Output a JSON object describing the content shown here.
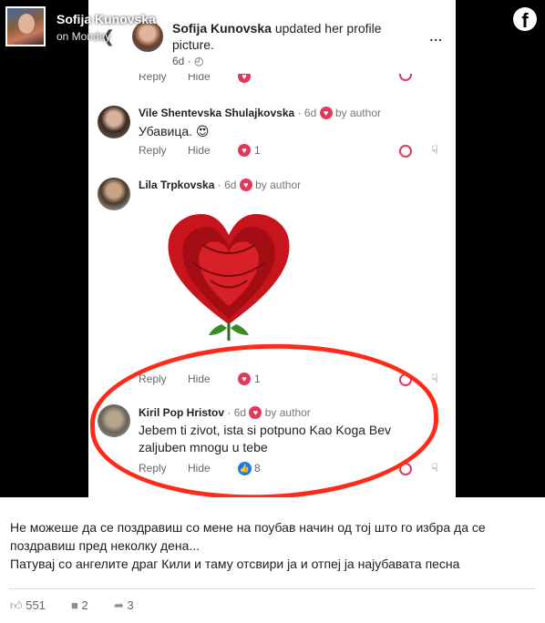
{
  "post": {
    "author": "Sofija Kunovska",
    "time": "on Monday"
  },
  "screenshot": {
    "title_name": "Sofija Kunovska",
    "title_rest": "updated her profile picture.",
    "time": "6d · ◴",
    "back_icon": "chevron-left-icon",
    "more": "...",
    "top_row": {
      "reply": "Reply",
      "hide": "Hide"
    },
    "comments": [
      {
        "name": "Vile Shentevska Shulajkovska",
        "time": "6d",
        "by_author": "by author",
        "text": "Убавица. 😍",
        "reply": "Reply",
        "hide": "Hide",
        "count": "1"
      },
      {
        "name": "Lila Trpkovska",
        "time": "6d",
        "by_author": "by author",
        "image": "heart-rose",
        "reply": "Reply",
        "hide": "Hide",
        "count": "1"
      },
      {
        "name": "Kiril Pop Hristov",
        "time": "6d",
        "by_author": "by author",
        "text": "Jebem ti zivot, ista si potpuno Kao Koga Bev zaljuben mnogu u tebe",
        "reply": "Reply",
        "hide": "Hide",
        "count": "8"
      }
    ]
  },
  "caption": {
    "line1": "Не можеше да се поздравиш со мене на поубав начин од тој што го избра да се",
    "line2": "поздравиш пред неколку дена...",
    "line3": "Патувај со ангелите драг Кили и таму отсвири ја и отпеј ја најубавата песна"
  },
  "stats": {
    "likes": "551",
    "comments": "2",
    "shares": "3"
  },
  "colors": {
    "facebook_blue": "#1877f2",
    "heart_red": "#e03a5a",
    "circle_red": "#ff2a1a"
  }
}
